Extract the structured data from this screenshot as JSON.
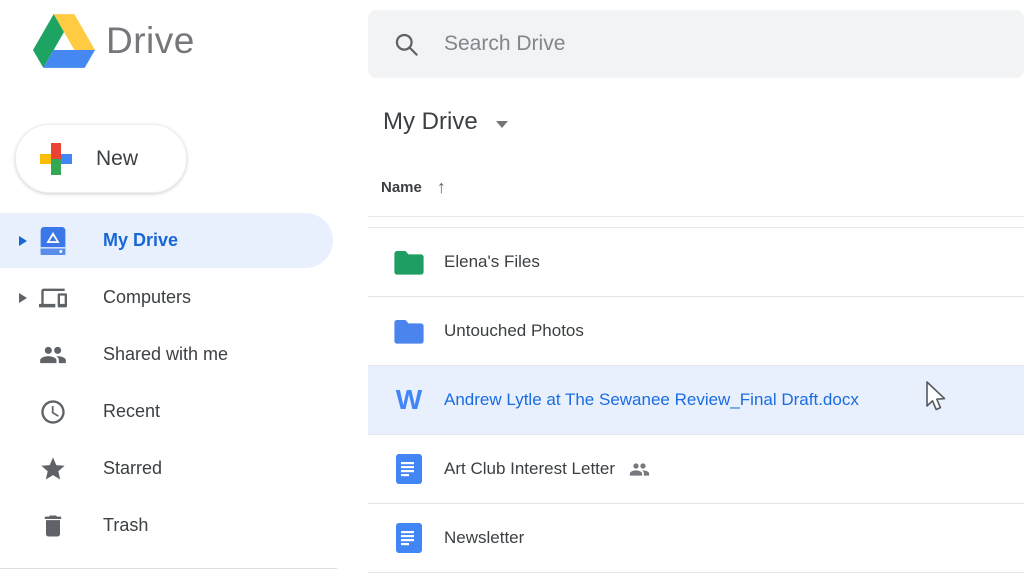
{
  "app": {
    "logo_text": "Drive"
  },
  "sidebar": {
    "new_button_label": "New",
    "items": [
      {
        "label": "My Drive",
        "selected": true,
        "expandable": true
      },
      {
        "label": "Computers",
        "selected": false,
        "expandable": true
      },
      {
        "label": "Shared with me",
        "selected": false,
        "expandable": false
      },
      {
        "label": "Recent",
        "selected": false,
        "expandable": false
      },
      {
        "label": "Starred",
        "selected": false,
        "expandable": false
      },
      {
        "label": "Trash",
        "selected": false,
        "expandable": false
      }
    ]
  },
  "search": {
    "placeholder": "Search Drive",
    "value": ""
  },
  "main": {
    "breadcrumb_title": "My Drive",
    "list": {
      "name_header": "Name",
      "sort_direction": "ascending",
      "sort_arrow": "↑",
      "rows": [
        {
          "name": "Elena's Files",
          "type": "folder",
          "icon_color": "#1e9e62",
          "selected": false,
          "shared": false
        },
        {
          "name": "Untouched Photos",
          "type": "folder",
          "icon_color": "#4c84ee",
          "selected": false,
          "shared": false
        },
        {
          "name": "Andrew Lytle at The Sewanee Review_Final Draft.docx",
          "type": "word-doc",
          "icon_color": "#4285f4",
          "selected": true,
          "shared": false
        },
        {
          "name": "Art Club Interest Letter",
          "type": "google-doc",
          "icon_color": "#4285f4",
          "selected": false,
          "shared": true
        },
        {
          "name": "Newsletter",
          "type": "google-doc",
          "icon_color": "#4285f4",
          "selected": false,
          "shared": false
        }
      ]
    }
  },
  "colors": {
    "accent_blue": "#1967d2",
    "selected_row_bg": "#e8f0fe",
    "selected_text": "#1b6ce0",
    "search_bg": "#f1f3f4",
    "icon_gray": "#5f6368",
    "text_dark": "#3c4043",
    "logo_green": "#1da462",
    "logo_yellow": "#fecb43",
    "logo_blue": "#4688f1",
    "plus_red": "#ea4335",
    "plus_green": "#34a853",
    "plus_yellow": "#fbbc04",
    "plus_blue": "#4285f4"
  }
}
